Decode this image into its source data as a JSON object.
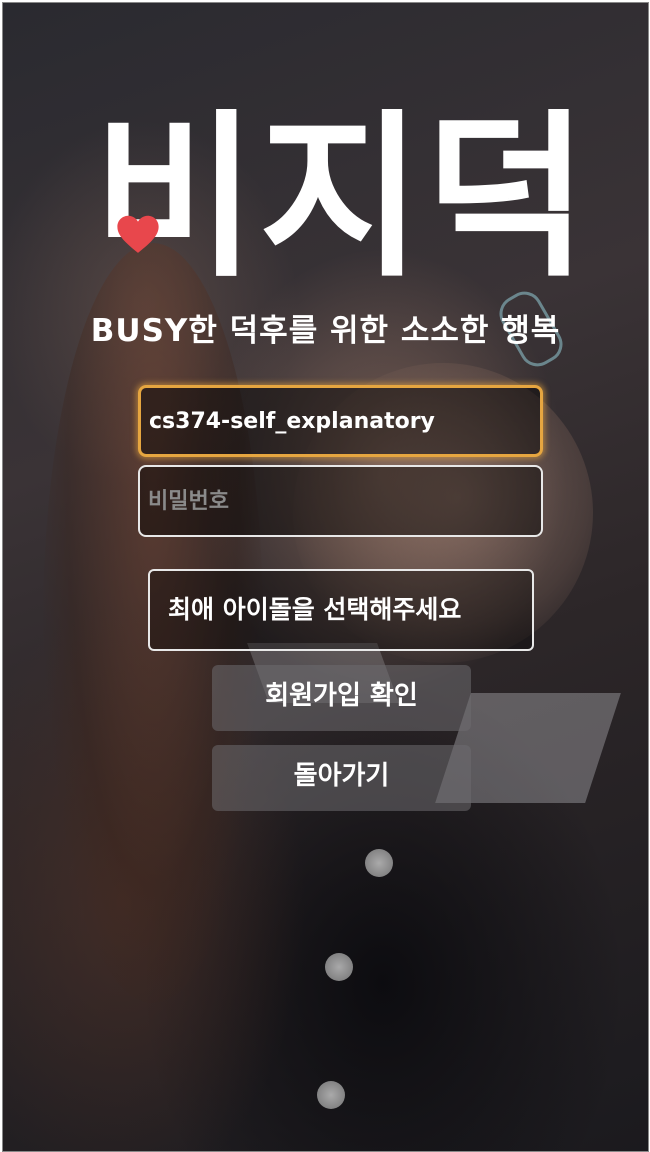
{
  "app": {
    "logo_text": "비지덕",
    "tagline": "BUSY한 덕후를 위한 소소한 행복"
  },
  "form": {
    "id_value": "cs374-self_explanatory",
    "password_placeholder": "비밀번호",
    "idol_select_label": "최애 아이돌을 선택해주세요",
    "confirm_label": "회원가입 확인",
    "back_label": "돌아가기"
  },
  "colors": {
    "focus_border": "#e6a640",
    "heart": "#e8474c",
    "text": "#ffffff"
  },
  "icons": {
    "logo_heart": "heart-icon"
  }
}
